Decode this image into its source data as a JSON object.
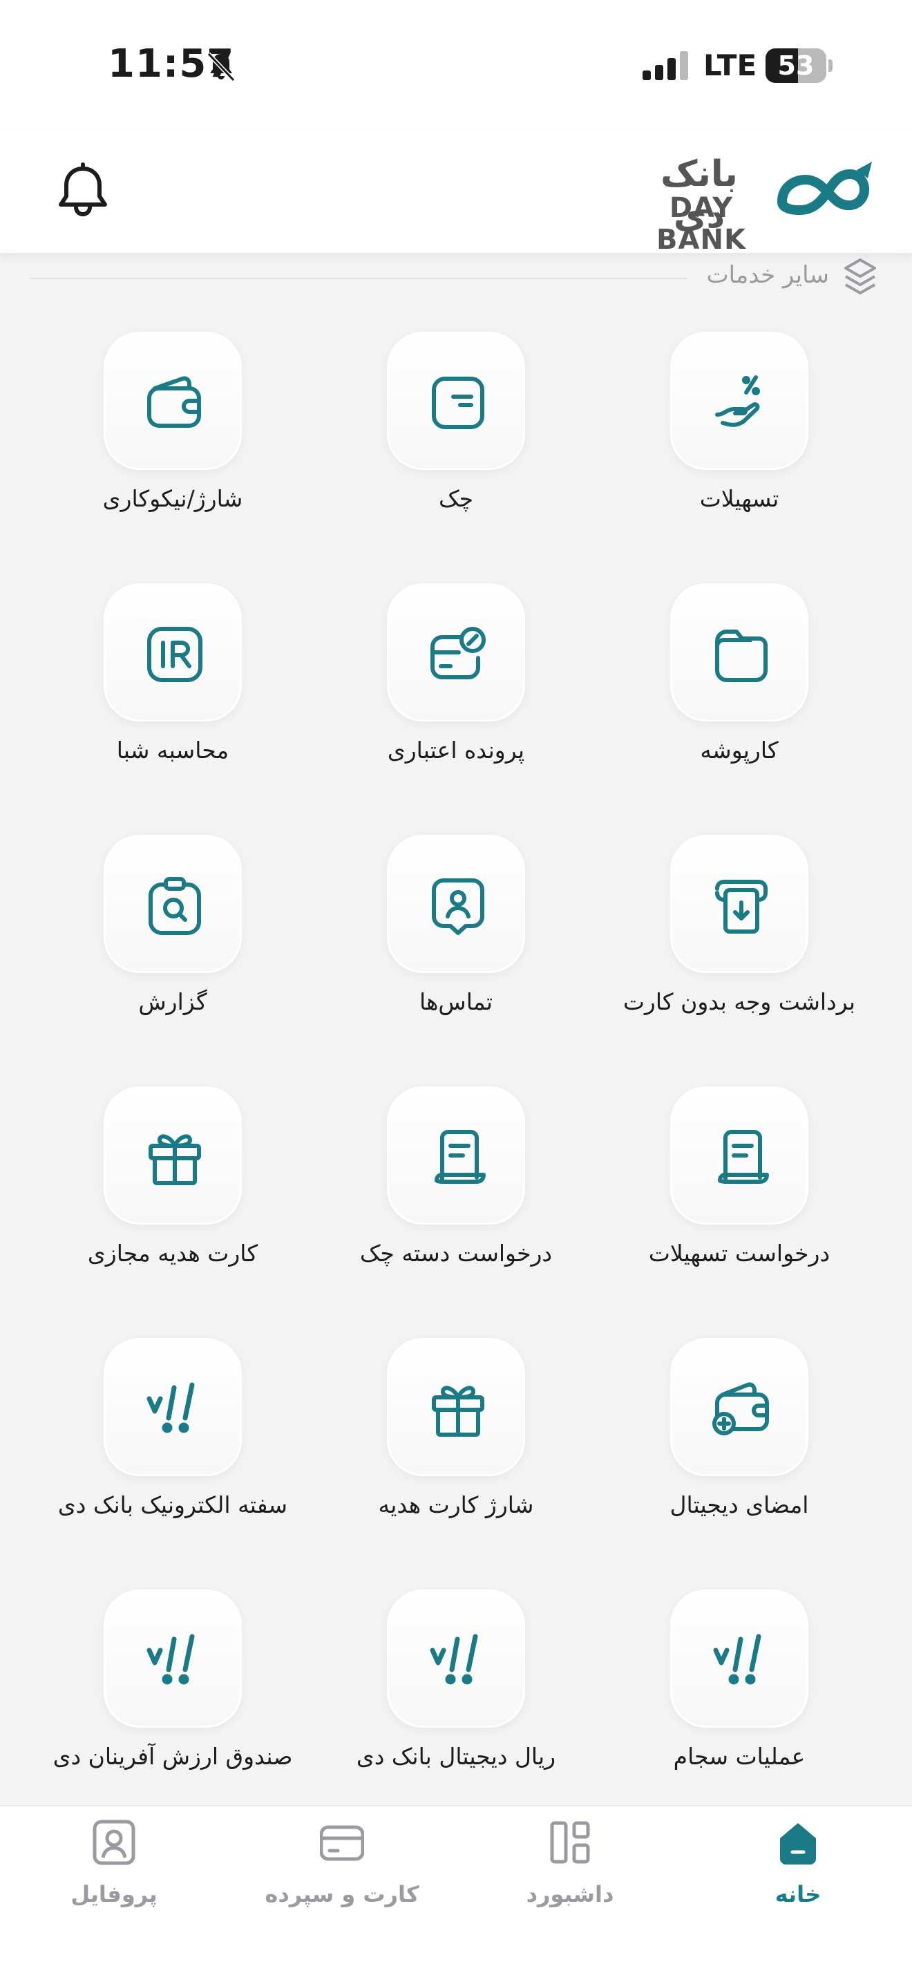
{
  "status": {
    "time": "11:57",
    "network": "LTE",
    "battery": "53",
    "battery_level": 0.53
  },
  "header": {
    "logo_fa": "بانک دی",
    "logo_en": "DAY BANK"
  },
  "section": {
    "title": "سایر خدمات"
  },
  "colors": {
    "accent": "#1a7a86",
    "muted": "#9a9aa0"
  },
  "services": [
    {
      "label": "تسهیلات",
      "icon": "hand-percent-icon"
    },
    {
      "label": "چک",
      "icon": "cheque-icon"
    },
    {
      "label": "شارژ/نیکوکاری",
      "icon": "wallet-icon"
    },
    {
      "label": "کارپوشه",
      "icon": "folder-icon"
    },
    {
      "label": "پرونده اعتباری",
      "icon": "credit-card-percent-icon"
    },
    {
      "label": "محاسبه شبا",
      "icon": "ir-icon"
    },
    {
      "label": "برداشت وجه بدون کارت",
      "icon": "atm-withdraw-icon"
    },
    {
      "label": "تماس‌ها",
      "icon": "contact-icon"
    },
    {
      "label": "گزارش",
      "icon": "report-search-icon"
    },
    {
      "label": "درخواست تسهیلات",
      "icon": "document-icon"
    },
    {
      "label": "درخواست دسته چک",
      "icon": "document-icon"
    },
    {
      "label": "کارت هدیه مجازی",
      "icon": "gift-icon"
    },
    {
      "label": "امضای دیجیتال",
      "icon": "wallet-plus-icon"
    },
    {
      "label": "شارژ کارت هدیه",
      "icon": "gift-icon"
    },
    {
      "label": "سفته الکترونیک بانک دی",
      "icon": "day-bank-mark-icon"
    },
    {
      "label": "عملیات سجام",
      "icon": "day-bank-mark-icon"
    },
    {
      "label": "ریال دیجیتال بانک دی",
      "icon": "day-bank-mark-icon"
    },
    {
      "label": "صندوق ارزش آفرینان دی",
      "icon": "day-bank-mark-icon"
    }
  ],
  "nav": {
    "home": "خانه",
    "dashboard": "داشبورد",
    "cards": "کارت و سپرده",
    "profile": "پروفایل"
  }
}
